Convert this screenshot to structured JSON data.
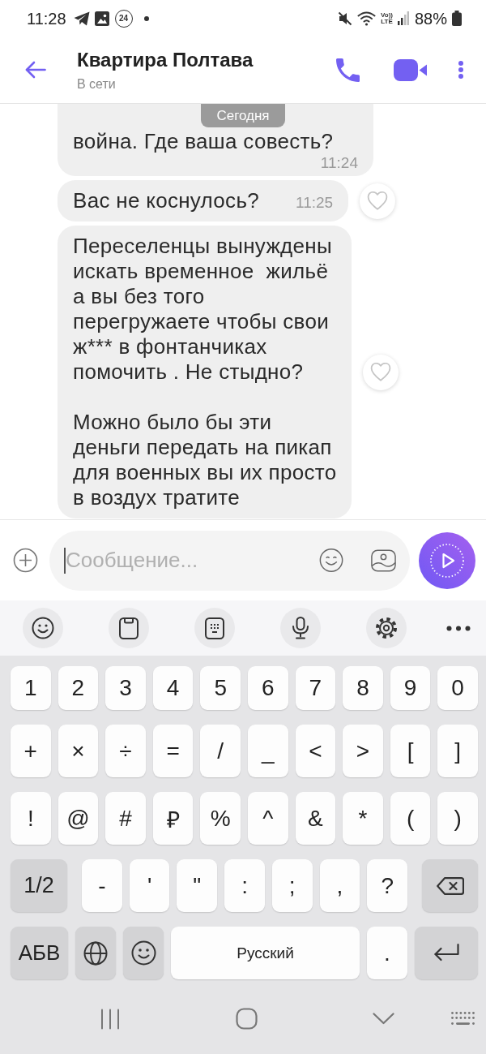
{
  "status_bar": {
    "time": "11:28",
    "notification_count": "24",
    "volte": [
      "Vo))",
      "LTE"
    ],
    "battery": "88%"
  },
  "header": {
    "title": "Квартира Полтава",
    "subtitle": "В сети"
  },
  "date_divider": "Сегодня",
  "messages": [
    {
      "text": "война. Где ваша совесть?",
      "time": "11:24",
      "reaction_button": false
    },
    {
      "text": "Вас не коснулось?",
      "time": "11:25",
      "reaction_button": true
    },
    {
      "text": "Переселенцы вынуждены\nискать временное  жильё\nа вы без того\nперегружаете чтобы свои\nж*** в фонтанчиках\nпомочить . Не стыдно?\n\nМожно было бы эти\nденьги передать на пикап\nдля военных вы их просто\nв воздух тратите",
      "reaction_button": true
    }
  ],
  "composer": {
    "placeholder": "Сообщение..."
  },
  "keyboard": {
    "toolbar": [
      {
        "kind": "emoji"
      },
      {
        "kind": "clipboard"
      },
      {
        "kind": "keypad"
      },
      {
        "kind": "mic"
      },
      {
        "kind": "settings"
      },
      {
        "kind": "more"
      }
    ],
    "rows": [
      {
        "keys": [
          {
            "kind": "char",
            "label": "1"
          },
          {
            "kind": "char",
            "label": "2"
          },
          {
            "kind": "char",
            "label": "3"
          },
          {
            "kind": "char",
            "label": "4"
          },
          {
            "kind": "char",
            "label": "5"
          },
          {
            "kind": "char",
            "label": "6"
          },
          {
            "kind": "char",
            "label": "7"
          },
          {
            "kind": "char",
            "label": "8"
          },
          {
            "kind": "char",
            "label": "9"
          },
          {
            "kind": "char",
            "label": "0"
          }
        ]
      },
      {
        "keys": [
          {
            "kind": "char",
            "label": "+"
          },
          {
            "kind": "char",
            "label": "×"
          },
          {
            "kind": "char",
            "label": "÷"
          },
          {
            "kind": "char",
            "label": "="
          },
          {
            "kind": "char",
            "label": "/"
          },
          {
            "kind": "char",
            "label": "_"
          },
          {
            "kind": "char",
            "label": "<"
          },
          {
            "kind": "char",
            "label": ">"
          },
          {
            "kind": "char",
            "label": "["
          },
          {
            "kind": "char",
            "label": "]"
          }
        ]
      },
      {
        "keys": [
          {
            "kind": "char",
            "label": "!"
          },
          {
            "kind": "char",
            "label": "@"
          },
          {
            "kind": "char",
            "label": "#"
          },
          {
            "kind": "char",
            "label": "₽"
          },
          {
            "kind": "char",
            "label": "%"
          },
          {
            "kind": "char",
            "label": "^"
          },
          {
            "kind": "char",
            "label": "&"
          },
          {
            "kind": "char",
            "label": "*"
          },
          {
            "kind": "char",
            "label": "("
          },
          {
            "kind": "char",
            "label": ")"
          }
        ]
      },
      {
        "keys": [
          {
            "kind": "page",
            "label": "1/2"
          },
          {
            "kind": "char",
            "label": "-"
          },
          {
            "kind": "char",
            "label": "'"
          },
          {
            "kind": "char",
            "label": "\""
          },
          {
            "kind": "char",
            "label": ":"
          },
          {
            "kind": "char",
            "label": ";"
          },
          {
            "kind": "char",
            "label": ","
          },
          {
            "kind": "char",
            "label": "?"
          },
          {
            "kind": "backspace"
          }
        ]
      },
      {
        "keys": [
          {
            "kind": "alphabet",
            "label": "АБВ"
          },
          {
            "kind": "globe"
          },
          {
            "kind": "emoji"
          },
          {
            "kind": "space",
            "label": "Русский"
          },
          {
            "kind": "char",
            "label": "."
          },
          {
            "kind": "enter"
          }
        ]
      }
    ]
  }
}
